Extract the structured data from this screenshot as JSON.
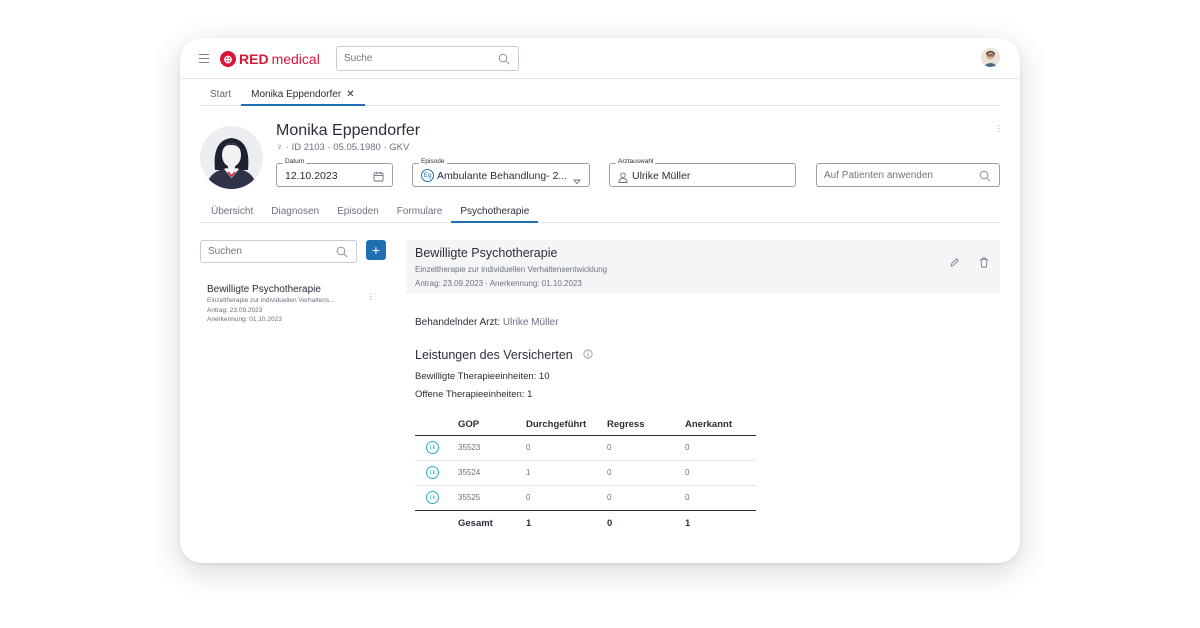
{
  "app": {
    "logo_red": "RED",
    "logo_medical": "medical",
    "logo_mark": "⊕"
  },
  "search": {
    "placeholder": "Suche"
  },
  "tabs": [
    {
      "label": "Start"
    },
    {
      "label": "Monika Eppendorfer"
    }
  ],
  "close_symbol": "✕",
  "patient": {
    "name": "Monika Eppendorfer",
    "meta": "♀ · ID 2103 · 05.05.1980 · GKV"
  },
  "fields": {
    "datum": {
      "label": "Datum",
      "value": "12.10.2023"
    },
    "episode": {
      "label": "Episode",
      "badge": "Eg",
      "value": "Ambulante Behandlung- 2..."
    },
    "arzt": {
      "label": "Arztauswahl",
      "value": "Ulrike Müller"
    },
    "apply": {
      "placeholder": "Auf Patienten anwenden"
    }
  },
  "nav": [
    {
      "label": "Übersicht"
    },
    {
      "label": "Diagnosen"
    },
    {
      "label": "Episoden"
    },
    {
      "label": "Formulare"
    },
    {
      "label": "Psychotherapie"
    }
  ],
  "sidebar": {
    "search_placeholder": "Suchen",
    "add_label": "+",
    "item": {
      "title": "Bewilligte Psychotherapie",
      "subtitle": "Einzeltherapie zur individuellen Verhaltens...",
      "antrag": "Antrag: 23.09.2023",
      "anerkennung": "Anerkennung: 01.10.2023"
    }
  },
  "detail": {
    "title": "Bewilligte Psychotherapie",
    "subtitle": "Einzeltherapie zur individuellen Verhaltensentwicklung",
    "dates": "Antrag: 23.09.2023 · Anerkennung: 01.10.2023",
    "doctor_label": "Behandelnder Arzt:",
    "doctor_value": "Ulrike Müller",
    "leistungen_title": "Leistungen des Versicherten",
    "bewilligt": "Bewilligte Therapieeinheiten: 10",
    "offen": "Offene Therapieeinheiten: 1"
  },
  "table": {
    "headers": {
      "gop": "GOP",
      "durch": "Durchgeführt",
      "regress": "Regress",
      "anerkannt": "Anerkannt"
    },
    "rows": [
      {
        "badge": "Lk",
        "gop": "35523",
        "durch": "0",
        "regress": "0",
        "anerkannt": "0"
      },
      {
        "badge": "Lk",
        "gop": "35524",
        "durch": "1",
        "regress": "0",
        "anerkannt": "0"
      },
      {
        "badge": "Lk",
        "gop": "35525",
        "durch": "0",
        "regress": "0",
        "anerkannt": "0"
      }
    ],
    "total": {
      "label": "Gesamt",
      "durch": "1",
      "regress": "0",
      "anerkannt": "1"
    }
  },
  "colors": {
    "accent": "#1f6fb2",
    "brand": "#d6173a",
    "lk": "#2ab3b8"
  }
}
